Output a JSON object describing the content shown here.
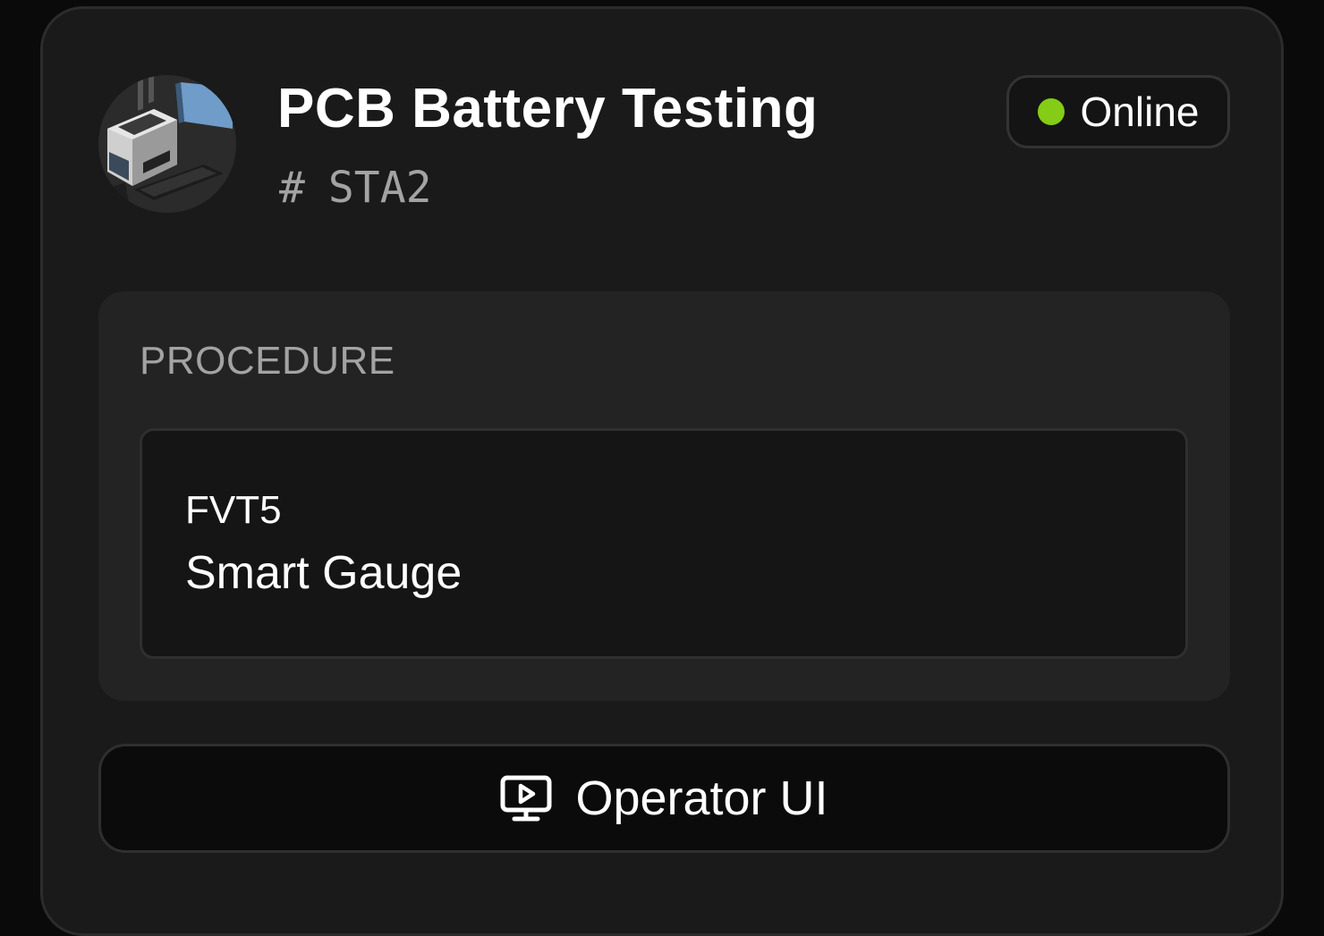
{
  "station": {
    "title": "PCB Battery Testing",
    "hash_symbol": "#",
    "id": "STA2",
    "status": {
      "label": "Online",
      "color": "#84cc16"
    },
    "thumbnail_icon": "battery-tester-photo"
  },
  "procedure": {
    "section_label": "PROCEDURE",
    "code": "FVT5",
    "name": "Smart Gauge"
  },
  "actions": {
    "operator_ui_label": "Operator UI",
    "operator_ui_icon": "monitor-play-icon"
  },
  "colors": {
    "background": "#0a0a0a",
    "card": "#1a1a1a",
    "accent_online": "#84cc16"
  }
}
